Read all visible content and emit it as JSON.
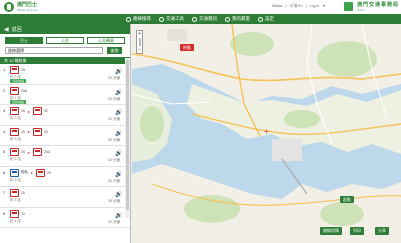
{
  "header": {
    "logo_title": "澳門巴士",
    "logo_subtitle": "Macau Bus Info",
    "util_links": [
      "Macau",
      "|",
      "中 簡 En",
      "|",
      "Log in",
      "▼"
    ],
    "brand_title": "澳門交通事務局",
    "brand_subtitle": "DSAT"
  },
  "nav": {
    "items": [
      "路線搜尋",
      "交通工具",
      "交通資訊",
      "我的最愛",
      "設定"
    ]
  },
  "panel": {
    "title": "返回",
    "modes": [
      "巴士",
      "公交",
      "公交轉乘"
    ],
    "active_mode": 0,
    "search_value": "路線選擇",
    "search_button": "查詢",
    "results_header": "共 10 條結果"
  },
  "routes": [
    {
      "idx": "1",
      "legs": [
        {
          "num": "26"
        }
      ],
      "meta": "約 2 站",
      "tag": "沿途站點",
      "duration": "25 分鐘",
      "transfer": ""
    },
    {
      "idx": "2",
      "legs": [
        {
          "num": "26A"
        }
      ],
      "meta": "約 2 站",
      "tag": "沿途站點",
      "duration": "25 分鐘",
      "transfer": ""
    },
    {
      "idx": "3",
      "legs": [
        {
          "num": "26"
        },
        {
          "num": "32"
        }
      ],
      "meta": "約 3 站",
      "tag": "",
      "duration": "30 分鐘",
      "transfer": "▸"
    },
    {
      "idx": "4",
      "legs": [
        {
          "num": "26"
        },
        {
          "num": "33"
        }
      ],
      "meta": "約 3 站",
      "tag": "",
      "duration": "30 分鐘",
      "transfer": "▸"
    },
    {
      "idx": "5",
      "legs": [
        {
          "num": "26"
        },
        {
          "num": "26A"
        }
      ],
      "meta": "約 3 站",
      "tag": "",
      "duration": "32 分鐘",
      "transfer": "▸"
    },
    {
      "idx": "6",
      "legs": [
        {
          "num": "輕軌"
        },
        {
          "num": "25"
        }
      ],
      "meta": "約 3 站",
      "tag": "",
      "duration": "35 分鐘",
      "transfer": "▸"
    },
    {
      "idx": "7",
      "legs": [
        {
          "num": "26"
        }
      ],
      "meta": "約 3 站",
      "tag": "",
      "duration": "38 分鐘",
      "transfer": ""
    },
    {
      "idx": "8",
      "legs": [
        {
          "num": "32"
        }
      ],
      "meta": "約 4 站",
      "tag": "",
      "duration": "40 分鐘",
      "transfer": ""
    }
  ],
  "map": {
    "end_label": "終點",
    "start_label": "起點",
    "zoom_in": "+",
    "zoom_out": "−",
    "buttons": [
      "路線詳情",
      "列印",
      "分享"
    ]
  },
  "colors": {
    "brand_green": "#2e7d36",
    "accent_red": "#d62c2c",
    "water": "#bcd8ea",
    "land": "#f2efe6"
  }
}
